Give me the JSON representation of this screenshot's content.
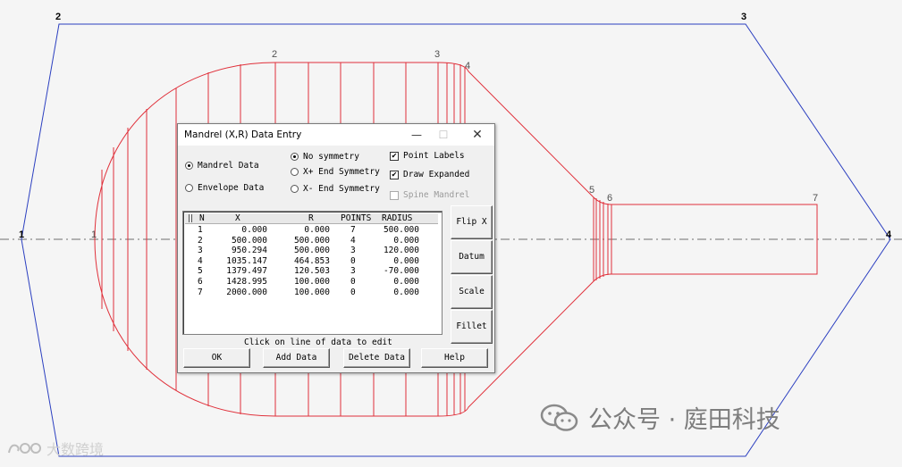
{
  "envelope_points": [
    "1",
    "2",
    "3",
    "4"
  ],
  "mandrel_points": [
    "1",
    "2",
    "3",
    "4",
    "5",
    "6",
    "7"
  ],
  "dialog": {
    "title": "Mandrel (X,R) Data Entry",
    "minimize": "—",
    "maximize": "☐",
    "close": "✕",
    "mode_options": [
      {
        "label": "Mandrel Data",
        "selected": true
      },
      {
        "label": "Envelope Data",
        "selected": false
      }
    ],
    "symmetry_options": [
      {
        "label": "No symmetry",
        "selected": true
      },
      {
        "label": "X+ End Symmetry",
        "selected": false
      },
      {
        "label": "X- End Symmetry",
        "selected": false
      }
    ],
    "checkboxes": [
      {
        "label": "Point Labels",
        "checked": true,
        "enabled": true
      },
      {
        "label": "Draw Expanded",
        "checked": true,
        "enabled": true
      },
      {
        "label": "Spine Mandrel",
        "checked": false,
        "enabled": false
      }
    ],
    "table": {
      "headers": [
        "N",
        "X",
        "R",
        "POINTS",
        "RADIUS"
      ],
      "rows": [
        [
          "1",
          "0.000",
          "0.000",
          "7",
          "500.000"
        ],
        [
          "2",
          "500.000",
          "500.000",
          "4",
          "0.000"
        ],
        [
          "3",
          "950.294",
          "500.000",
          "3",
          "120.000"
        ],
        [
          "4",
          "1035.147",
          "464.853",
          "0",
          "0.000"
        ],
        [
          "5",
          "1379.497",
          "120.503",
          "3",
          "-70.000"
        ],
        [
          "6",
          "1428.995",
          "100.000",
          "0",
          "0.000"
        ],
        [
          "7",
          "2000.000",
          "100.000",
          "0",
          "0.000"
        ]
      ]
    },
    "side_buttons": [
      "Flip X",
      "Datum",
      "Scale",
      "Fillet"
    ],
    "status_text": "Click on line of data to edit",
    "bottom_buttons": [
      "OK",
      "Add Data",
      "Delete Data",
      "Help"
    ]
  },
  "watermark": {
    "text": "公众号 · 庭田科技"
  },
  "bottom_logo": {
    "text": "大数跨境"
  },
  "colors": {
    "envelope": "#2b3fc0",
    "mandrel": "#e0303a",
    "axis": "#707070",
    "label": "#505050"
  }
}
